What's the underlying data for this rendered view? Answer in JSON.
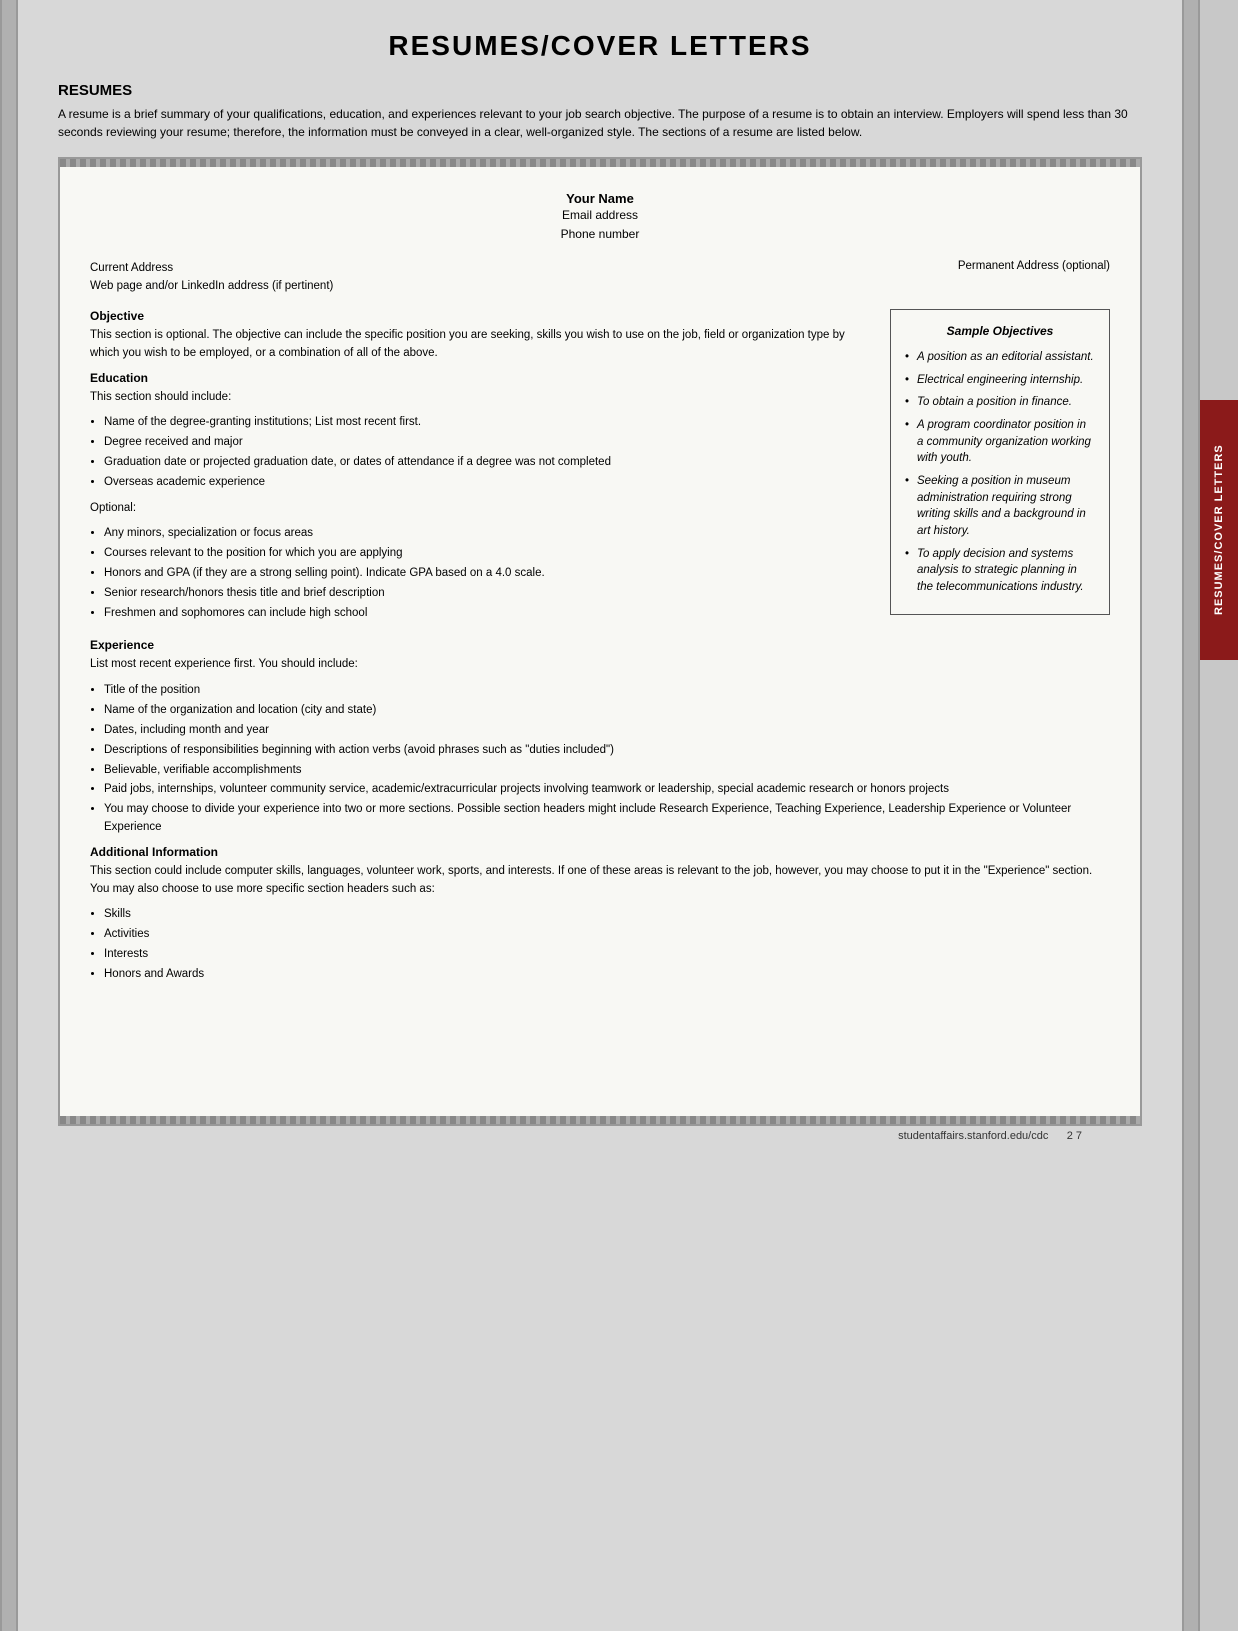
{
  "page": {
    "title": "RESUMES/COVER LETTERS",
    "side_tab_label": "RESUMES/COVER LETTERS",
    "footer_url": "studentaffairs.stanford.edu/cdc",
    "footer_page": "2 7"
  },
  "resumes_section": {
    "heading": "RESUMES",
    "intro": "A resume is a brief summary of your qualifications, education, and experiences relevant to your job search objective. The purpose of a resume is to obtain an interview. Employers will spend less than 30 seconds reviewing your resume; therefore, the information must be conveyed in a clear, well-organized style. The sections of a resume are listed below."
  },
  "doc": {
    "name": "Your Name",
    "email": "Email address",
    "phone": "Phone number",
    "current_address_label": "Current Address",
    "web_label": "Web page and/or LinkedIn address (if pertinent)",
    "permanent_address_label": "Permanent Address (optional)",
    "objective_heading": "Objective",
    "objective_text": "This section is optional. The objective can include the specific position you are seeking, skills you wish to use on the job, field or organization type by which you wish to be employed, or a combination of all of the above.",
    "education_heading": "Education",
    "education_intro": "This section should include:",
    "education_bullets": [
      "Name of the degree-granting institutions; List most recent first.",
      "Degree received and major",
      "Graduation date or projected graduation date, or dates of attendance if a degree was not completed",
      "Overseas academic experience"
    ],
    "optional_label": "Optional:",
    "optional_bullets": [
      "Any minors, specialization or focus areas",
      "Courses relevant to the position for which you are applying",
      "Honors and GPA (if they are a strong selling point). Indicate GPA based on a 4.0 scale.",
      "Senior research/honors thesis title and brief description",
      "Freshmen and sophomores can include high school"
    ],
    "experience_heading": "Experience",
    "experience_intro": "List most recent experience first. You should include:",
    "experience_bullets": [
      "Title of the position",
      "Name of the organization and location (city and state)",
      "Dates, including month and year",
      "Descriptions of responsibilities beginning with action verbs (avoid phrases such as \"duties included\")",
      "Believable, verifiable accomplishments",
      "Paid jobs, internships, volunteer community service, academic/extracurricular projects involving teamwork or leadership, special academic research or honors projects",
      "You may choose to divide your experience into two or more sections. Possible section headers might include Research Experience, Teaching Experience, Leadership Experience or Volunteer Experience"
    ],
    "additional_info_heading": "Additional Information",
    "additional_info_text": "This section could include computer skills, languages, volunteer work, sports, and interests. If one of these areas is relevant to the job, however, you may choose to put it in the \"Experience\" section. You may also choose to use more specific section headers such as:",
    "additional_info_bullets": [
      "Skills",
      "Activities",
      "Interests",
      "Honors and Awards"
    ],
    "sample_objectives": {
      "title": "Sample Objectives",
      "items": [
        "A position as an editorial assistant.",
        "Electrical engineering internship.",
        "To obtain a position in finance.",
        "A program coordinator position in a community organization working with youth.",
        "Seeking a position in museum administration requiring strong writing skills and a background in art history.",
        "To apply decision and systems analysis to strategic planning in the telecommunications industry."
      ]
    }
  }
}
